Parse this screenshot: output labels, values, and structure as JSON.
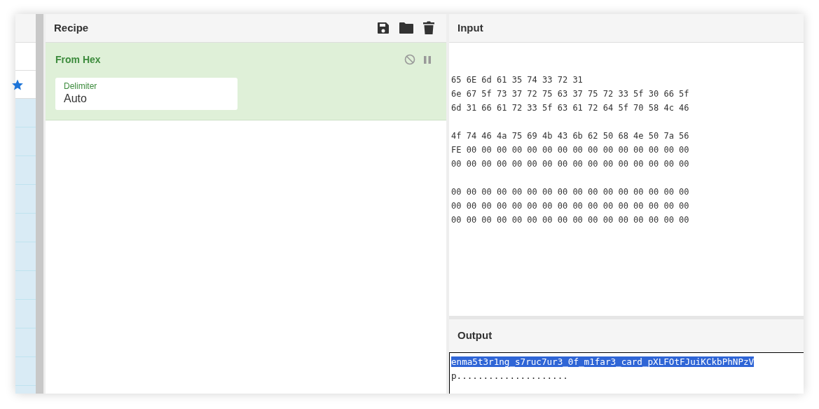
{
  "recipe": {
    "title": "Recipe",
    "operations": [
      {
        "name": "From Hex",
        "disabled": false,
        "paused": false,
        "args": [
          {
            "label": "Delimiter",
            "value": "Auto"
          }
        ]
      }
    ]
  },
  "input": {
    "title": "Input",
    "blocks": [
      [
        "65 6E 6d 61 35 74 33 72 31",
        "6e 67 5f 73 37 72 75 63 37 75 72 33 5f 30 66 5f",
        "6d 31 66 61 72 33 5f 63 61 72 64 5f 70 58 4c 46"
      ],
      [
        "4f 74 46 4a 75 69 4b 43 6b 62 50 68 4e 50 7a 56",
        "FE 00 00 00 00 00 00 00 00 00 00 00 00 00 00 00",
        "00 00 00 00 00 00 00 00 00 00 00 00 00 00 00 00"
      ],
      [
        "00 00 00 00 00 00 00 00 00 00 00 00 00 00 00 00",
        "00 00 00 00 00 00 00 00 00 00 00 00 00 00 00 00",
        "00 00 00 00 00 00 00 00 00 00 00 00 00 00 00 00"
      ]
    ]
  },
  "output": {
    "title": "Output",
    "segments": [
      {
        "text": "enma5t3r1ng_s7ruc7ur3_0f_m1far3_card_pXLFOtFJuiKCkbPhNPzV",
        "selected": true
      },
      {
        "text": "p.....................",
        "selected": false
      }
    ]
  }
}
